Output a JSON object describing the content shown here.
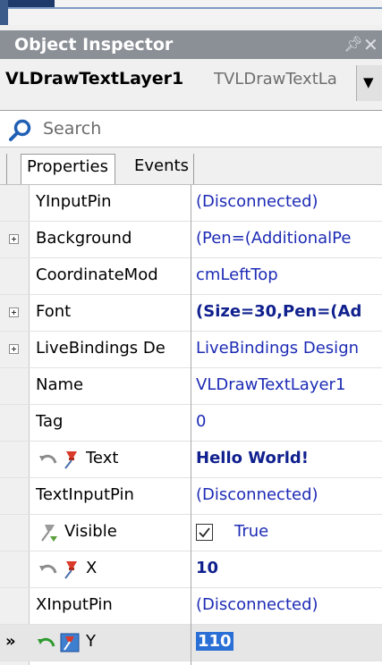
{
  "panel": {
    "title": "Object Inspector"
  },
  "object": {
    "name": "VLDrawTextLayer1",
    "type": "TVLDrawTextLa"
  },
  "search": {
    "placeholder": "Search"
  },
  "tabs": [
    {
      "label": "Properties"
    },
    {
      "label": "Events"
    }
  ],
  "properties": [
    {
      "name": "YInputPin",
      "value": "(Disconnected)"
    },
    {
      "name": "Background",
      "value": "(Pen=(AdditionalPe"
    },
    {
      "name": "CoordinateMod",
      "value": "cmLeftTop"
    },
    {
      "name": "Font",
      "value": "(Size=30,Pen=(Ad"
    },
    {
      "name": "LiveBindings De",
      "value": "LiveBindings Design"
    },
    {
      "name": "Name",
      "value": "VLDrawTextLayer1"
    },
    {
      "name": "Tag",
      "value": "0"
    },
    {
      "name": "Text",
      "value": "Hello World!"
    },
    {
      "name": "TextInputPin",
      "value": "(Disconnected)"
    },
    {
      "name": "Visible",
      "value": "True",
      "checked": true
    },
    {
      "name": "X",
      "value": "10"
    },
    {
      "name": "XInputPin",
      "value": "(Disconnected)"
    },
    {
      "name": "Y",
      "value": "110"
    }
  ],
  "colors": {
    "titlebar": "#8b8f96",
    "value_text": "#1d2bb5",
    "selection": "#2a6fd5"
  }
}
